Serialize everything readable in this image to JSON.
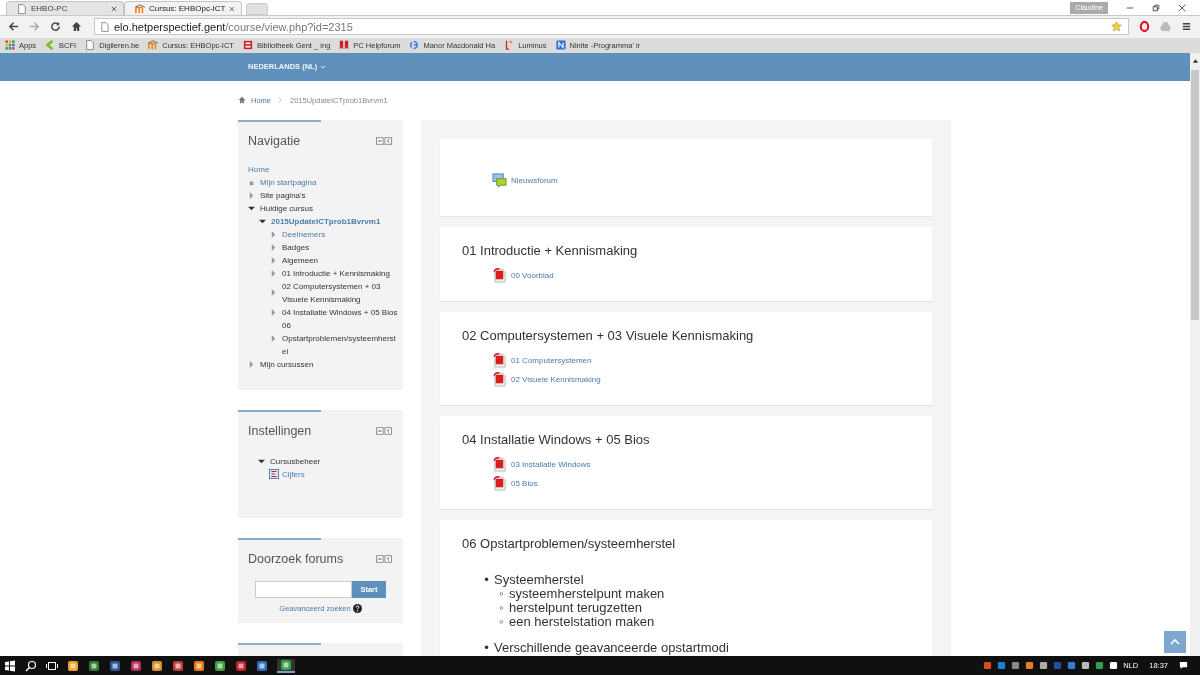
{
  "browser": {
    "tabs": [
      {
        "label": "EHBO-PC",
        "selected": false
      },
      {
        "label": "Cursus: EHBOpc-ICT",
        "selected": true
      }
    ],
    "user": "Claudine",
    "url": {
      "host": "elo.hetperspectief.gent",
      "path": "/course/view.php?id=2315"
    },
    "bookmarks": [
      "Apps",
      "BCFI",
      "Digileren.be",
      "Cursus: EHBOpc-ICT",
      "Bibliotheek Gent _ ing",
      "PC Helpforum",
      "Manor Macdonald Ha",
      "Luminus",
      "Ninite -Programma' ir"
    ]
  },
  "top_bar": {
    "language": "NEDERLANDS (NL)"
  },
  "breadcrumb": [
    "Home",
    "2015UpdateICTprob1Bvrvm1"
  ],
  "navigation": {
    "title": "Navigatie",
    "items": [
      {
        "label": "Home",
        "kind": "plain",
        "link": true,
        "active": false
      },
      {
        "label": "Mijn startpagina",
        "kind": "leaf",
        "link": true,
        "active": false
      },
      {
        "label": "Site pagina's",
        "kind": "branch",
        "expanded": false,
        "link": false,
        "active": false
      },
      {
        "label": "Huidige cursus",
        "kind": "branch",
        "expanded": true,
        "link": false,
        "active": false,
        "children": [
          {
            "label": "2015UpdateICTprob1Bvrvm1",
            "kind": "branch",
            "expanded": true,
            "link": true,
            "active": true,
            "children": [
              {
                "label": "Deelnemers",
                "kind": "branch",
                "expanded": false,
                "link": true,
                "active": false
              },
              {
                "label": "Badges",
                "kind": "branch",
                "expanded": false,
                "link": false,
                "active": false
              },
              {
                "label": "Algemeen",
                "kind": "branch",
                "expanded": false,
                "link": false,
                "active": false
              },
              {
                "label": "01 Introductie + Kennismaking",
                "kind": "branch",
                "expanded": false,
                "link": false,
                "active": false
              },
              {
                "label": "02 Computersystemen + 03 Visuele Kennismaking",
                "kind": "branch",
                "expanded": false,
                "link": false,
                "active": false
              },
              {
                "label": "04 Installatie Windows + 05 Bios",
                "kind": "branch",
                "expanded": false,
                "link": false,
                "active": false
              },
              {
                "label": "06 Opstartproblemen/systeemherstel",
                "kind": "branch",
                "expanded": false,
                "link": false,
                "active": false
              }
            ]
          }
        ]
      },
      {
        "label": "Mijn cursussen",
        "kind": "branch",
        "expanded": false,
        "link": false,
        "active": false
      }
    ]
  },
  "settings": {
    "title": "Instellingen",
    "items": [
      {
        "label": "Cursusbeheer",
        "kind": "branch",
        "expanded": true,
        "link": false,
        "active": false,
        "children": [
          {
            "label": "Cijfers",
            "kind": "grades",
            "link": true,
            "active": false
          }
        ]
      }
    ]
  },
  "forum_search": {
    "title": "Doorzoek forums",
    "button": "Start",
    "advanced_link": "Geavanceerd zoeken"
  },
  "sections": [
    {
      "activities": [
        {
          "label": "Nieuwsforum",
          "kind": "forum"
        }
      ]
    },
    {
      "title": "01 Introductie + Kennismaking",
      "activities": [
        {
          "label": "00 Voorblad",
          "kind": "pdf"
        }
      ]
    },
    {
      "title": "02 Computersystemen + 03 Visuele Kennismaking",
      "activities": [
        {
          "label": "01 Computersystemen",
          "kind": "pdf"
        },
        {
          "label": "02 Visuele Kennismaking",
          "kind": "pdf"
        }
      ]
    },
    {
      "title": "04 Installatie Windows + 05 Bios",
      "activities": [
        {
          "label": "03 Installatie Windows",
          "kind": "pdf"
        },
        {
          "label": "05 Bios",
          "kind": "pdf"
        }
      ]
    },
    {
      "title": "06 Opstartproblemen/systeemherstel",
      "bullets": [
        {
          "marker": "•",
          "text": "Systeemherstel",
          "children": [
            {
              "marker": "◦",
              "text": "systeemherstelpunt maken"
            },
            {
              "marker": "◦",
              "text": "herstelpunt terugzetten"
            },
            {
              "marker": "◦",
              "text": "een herstelstation maken"
            }
          ]
        },
        {
          "marker": "•",
          "text": "Verschillende geavanceerde opstartmodi"
        }
      ]
    }
  ],
  "taskbar": {
    "language": "NLD",
    "time": "18:37"
  }
}
